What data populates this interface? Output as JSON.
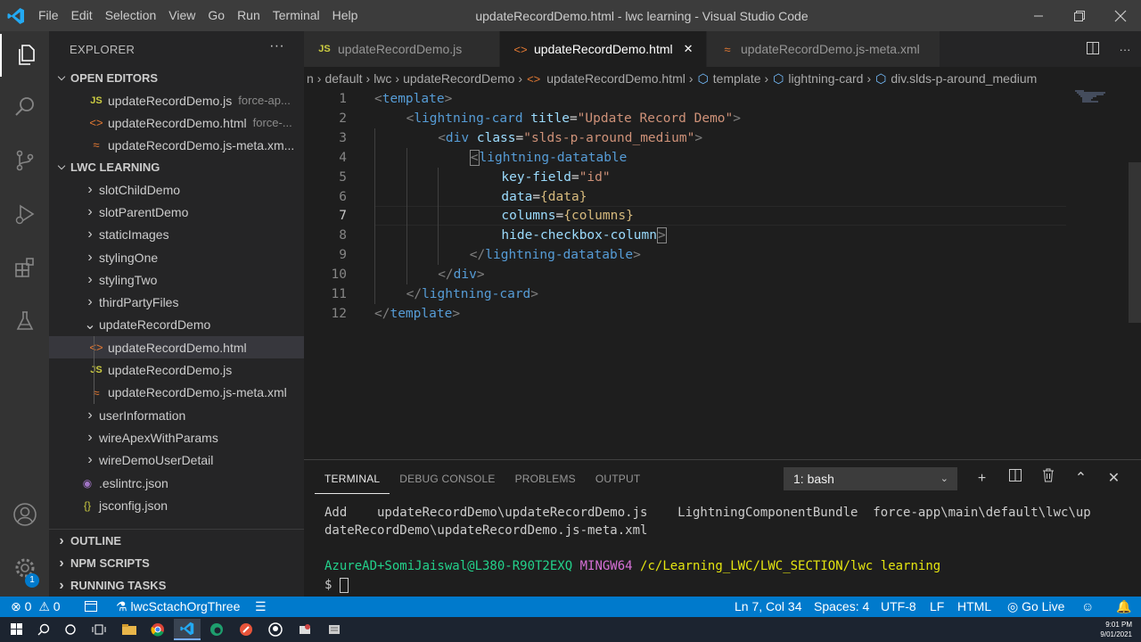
{
  "window": {
    "title": "updateRecordDemo.html - lwc learning - Visual Studio Code",
    "menu": [
      "File",
      "Edit",
      "Selection",
      "View",
      "Go",
      "Run",
      "Terminal",
      "Help"
    ]
  },
  "activity_bar": {
    "items": [
      "explorer-icon",
      "search-icon",
      "source-control-icon",
      "run-debug-icon",
      "extensions-icon",
      "testing-icon"
    ],
    "bottom": [
      "account-icon",
      "settings-gear-icon"
    ],
    "settings_badge": "1"
  },
  "sidebar": {
    "header": "EXPLORER",
    "open_editors": {
      "title": "OPEN EDITORS",
      "items": [
        {
          "icon": "JS",
          "name": "updateRecordDemo.js",
          "desc": "force-ap..."
        },
        {
          "icon": "<>",
          "name": "updateRecordDemo.html",
          "desc": "force-..."
        },
        {
          "icon": "xml",
          "name": "updateRecordDemo.js-meta.xm...",
          "desc": ""
        }
      ]
    },
    "workspace": {
      "title": "LWC LEARNING",
      "items": [
        {
          "name": "slotChildDemo",
          "kind": "folder-collapsed"
        },
        {
          "name": "slotParentDemo",
          "kind": "folder-collapsed"
        },
        {
          "name": "staticImages",
          "kind": "folder-collapsed"
        },
        {
          "name": "stylingOne",
          "kind": "folder-collapsed"
        },
        {
          "name": "stylingTwo",
          "kind": "folder-collapsed"
        },
        {
          "name": "thirdPartyFiles",
          "kind": "folder-collapsed"
        },
        {
          "name": "updateRecordDemo",
          "kind": "folder-expanded"
        },
        {
          "name": "updateRecordDemo.html",
          "kind": "html",
          "selected": true
        },
        {
          "name": "updateRecordDemo.js",
          "kind": "js"
        },
        {
          "name": "updateRecordDemo.js-meta.xml",
          "kind": "xml"
        },
        {
          "name": "userInformation",
          "kind": "folder-collapsed"
        },
        {
          "name": "wireApexWithParams",
          "kind": "folder-collapsed"
        },
        {
          "name": "wireDemoUserDetail",
          "kind": "folder-collapsed"
        },
        {
          "name": ".eslintrc.json",
          "kind": "eslint"
        },
        {
          "name": "jsconfig.json",
          "kind": "json"
        }
      ]
    },
    "bottom_sections": [
      "OUTLINE",
      "NPM SCRIPTS",
      "RUNNING TASKS"
    ]
  },
  "tabs": [
    {
      "icon": "JS",
      "label": "updateRecordDemo.js",
      "active": false
    },
    {
      "icon": "<>",
      "label": "updateRecordDemo.html",
      "active": true
    },
    {
      "icon": "xml",
      "label": "updateRecordDemo.js-meta.xml",
      "active": false
    }
  ],
  "breadcrumb": {
    "parts": [
      "n",
      "default",
      "lwc",
      "updateRecordDemo",
      "updateRecordDemo.html",
      "template",
      "lightning-card",
      "div.slds-p-around_medium"
    ]
  },
  "code": {
    "current_line": 7,
    "lines": [
      {
        "n": "1",
        "indent": 0,
        "tokens": [
          [
            "br",
            "<"
          ],
          [
            "tag",
            "template"
          ],
          [
            "br",
            ">"
          ]
        ]
      },
      {
        "n": "2",
        "indent": 1,
        "tokens": [
          [
            "br",
            "<"
          ],
          [
            "tag",
            "lightning-card"
          ],
          [
            "sp",
            " "
          ],
          [
            "attr",
            "title"
          ],
          [
            "eq",
            "="
          ],
          [
            "str",
            "\"Update Record Demo\""
          ],
          [
            "br",
            ">"
          ]
        ]
      },
      {
        "n": "3",
        "indent": 2,
        "tokens": [
          [
            "br",
            "<"
          ],
          [
            "tag",
            "div"
          ],
          [
            "sp",
            " "
          ],
          [
            "attr",
            "class"
          ],
          [
            "eq",
            "="
          ],
          [
            "str",
            "\"slds-p-around_medium\""
          ],
          [
            "br",
            ">"
          ]
        ]
      },
      {
        "n": "4",
        "indent": 3,
        "tokens": [
          [
            "brbox",
            "<"
          ],
          [
            "tag",
            "lightning-datatable"
          ]
        ]
      },
      {
        "n": "5",
        "indent": 4,
        "tokens": [
          [
            "attr",
            "key-field"
          ],
          [
            "eq",
            "="
          ],
          [
            "str",
            "\"id\""
          ]
        ]
      },
      {
        "n": "6",
        "indent": 4,
        "tokens": [
          [
            "attr",
            "data"
          ],
          [
            "eq",
            "="
          ],
          [
            "exp",
            "{data}"
          ]
        ]
      },
      {
        "n": "7",
        "indent": 4,
        "tokens": [
          [
            "attr",
            "columns"
          ],
          [
            "eq",
            "="
          ],
          [
            "exp",
            "{columns}"
          ]
        ]
      },
      {
        "n": "8",
        "indent": 4,
        "tokens": [
          [
            "attr",
            "hide-checkbox-column"
          ],
          [
            "brbox",
            ">"
          ]
        ]
      },
      {
        "n": "9",
        "indent": 3,
        "tokens": [
          [
            "br",
            "</"
          ],
          [
            "tag",
            "lightning-datatable"
          ],
          [
            "br",
            ">"
          ]
        ]
      },
      {
        "n": "10",
        "indent": 2,
        "tokens": [
          [
            "br",
            "</"
          ],
          [
            "tag",
            "div"
          ],
          [
            "br",
            ">"
          ]
        ]
      },
      {
        "n": "11",
        "indent": 1,
        "tokens": [
          [
            "br",
            "</"
          ],
          [
            "tag",
            "lightning-card"
          ],
          [
            "br",
            ">"
          ]
        ]
      },
      {
        "n": "12",
        "indent": 0,
        "tokens": [
          [
            "br",
            "</"
          ],
          [
            "tag",
            "template"
          ],
          [
            "br",
            ">"
          ]
        ]
      }
    ]
  },
  "panel": {
    "tabs": [
      "TERMINAL",
      "DEBUG CONSOLE",
      "PROBLEMS",
      "OUTPUT"
    ],
    "active_tab": "TERMINAL",
    "terminal_select": "1: bash",
    "lines": {
      "l1": "Add    updateRecordDemo\\updateRecordDemo.js    LightningComponentBundle  force-app\\main\\default\\lwc\\up",
      "l2": "dateRecordDemo\\updateRecordDemo.js-meta.xml",
      "user": "AzureAD+SomiJaiswal@L380-R90T2EXQ",
      "shell": "MINGW64",
      "path": "/c/Learning_LWC/LWC_SECTION/lwc learning",
      "prompt": "$"
    }
  },
  "status_bar": {
    "errors": "0",
    "warnings": "0",
    "org": "lwcSctachOrgThree",
    "position": "Ln 7, Col 34",
    "spaces": "Spaces: 4",
    "encoding": "UTF-8",
    "eol": "LF",
    "language": "HTML",
    "golive": "Go Live"
  },
  "taskbar": {
    "time": "9:01 PM",
    "date": "9/01/2021"
  },
  "colors": {
    "accent": "#007acc",
    "tag": "#569cd6",
    "attr": "#9cdcfe",
    "string": "#ce9178"
  }
}
